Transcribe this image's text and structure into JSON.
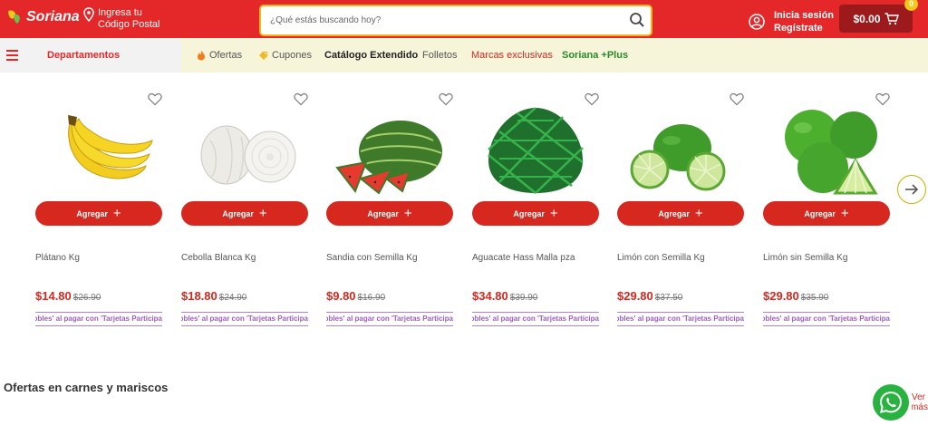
{
  "header": {
    "logo": "Soriana",
    "location_line1": "Ingresa tu",
    "location_line2": "Código Postal",
    "search_placeholder": "¿Qué estás buscando hoy?",
    "login_line1": "Inicia sesión",
    "login_line2": "Regístrate",
    "cart_total": "$0.00",
    "cart_count": "0"
  },
  "nav": {
    "departments": "Departamentos",
    "items": [
      "Ofertas",
      "Cupones",
      "Catálogo Extendido",
      "Folletos",
      "Marcas exclusivas",
      "Soriana +Plus"
    ]
  },
  "products": [
    {
      "name": "Plátano Kg",
      "price": "$14.80",
      "old_price": "$26.90",
      "add": "Agregar",
      "promo": "lobles' al pagar con 'Tarjetas Participa"
    },
    {
      "name": "Cebolla Blanca Kg",
      "price": "$18.80",
      "old_price": "$24.90",
      "add": "Agregar",
      "promo": "lobles' al pagar con 'Tarjetas Participa"
    },
    {
      "name": "Sandia con Semilla Kg",
      "price": "$9.80",
      "old_price": "$16.90",
      "add": "Agregar",
      "promo": "lobles' al pagar con 'Tarjetas Participa"
    },
    {
      "name": "Aguacate Hass Malla pza",
      "price": "$34.80",
      "old_price": "$39.90",
      "add": "Agregar",
      "promo": "lobles' al pagar con 'Tarjetas Participa"
    },
    {
      "name": "Limón con Semilla Kg",
      "price": "$29.80",
      "old_price": "$37.50",
      "add": "Agregar",
      "promo": "lobles' al pagar con 'Tarjetas Participa"
    },
    {
      "name": "Limón sin Semilla Kg",
      "price": "$29.80",
      "old_price": "$35.90",
      "add": "Agregar",
      "promo": "lobles' al pagar con 'Tarjetas Participa"
    }
  ],
  "section": {
    "title": "Ofertas en carnes y mariscos",
    "more": "Ver más"
  },
  "colors": {
    "brand_red": "#e4282a",
    "button_red": "#d6281f",
    "nav_bg": "#f7f5d9",
    "promo_purple": "#9b5fc0"
  }
}
